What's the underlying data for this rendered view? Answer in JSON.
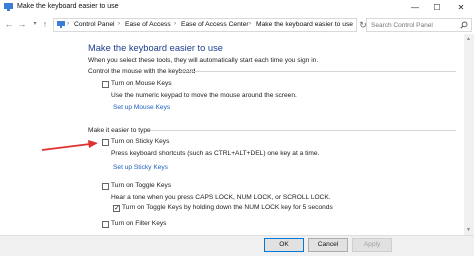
{
  "window": {
    "title": "Make the keyboard easier to use",
    "minimize_glyph": "—",
    "maximize_glyph": "☐",
    "close_glyph": "✕"
  },
  "address": {
    "crumbs": [
      "Control Panel",
      "Ease of Access",
      "Ease of Access Center",
      "Make the keyboard easier to use"
    ],
    "search_placeholder": "Search Control Panel"
  },
  "page": {
    "heading": "Make the keyboard easier to use",
    "intro": "When you select these tools, they will automatically start each time you sign in.",
    "mouse_section": {
      "title": "Control the mouse with the keyboard",
      "mouse_keys_label": "Turn on Mouse Keys",
      "mouse_keys_checked": false,
      "mouse_keys_desc": "Use the numeric keypad to move the mouse around the screen.",
      "mouse_keys_link": "Set up Mouse Keys"
    },
    "typing_section": {
      "title": "Make it easier to type",
      "sticky_keys_label": "Turn on Sticky Keys",
      "sticky_keys_checked": false,
      "sticky_keys_desc": "Press keyboard shortcuts (such as CTRL+ALT+DEL) one key at a time.",
      "sticky_keys_link": "Set up Sticky Keys",
      "toggle_keys_label": "Turn on Toggle Keys",
      "toggle_keys_checked": false,
      "toggle_keys_desc": "Hear a tone when you press CAPS LOCK, NUM LOCK, or SCROLL LOCK.",
      "toggle_keys_hold_label": "Turn on Toggle Keys by holding down the NUM LOCK key for 5 seconds",
      "toggle_keys_hold_checked": true,
      "filter_keys_label": "Turn on Filter Keys",
      "filter_keys_checked": false
    }
  },
  "buttons": {
    "ok": "OK",
    "cancel": "Cancel",
    "apply": "Apply"
  },
  "colors": {
    "heading": "#1c3f8f",
    "link": "#1f5fbf",
    "annotation_arrow": "#e03030"
  }
}
